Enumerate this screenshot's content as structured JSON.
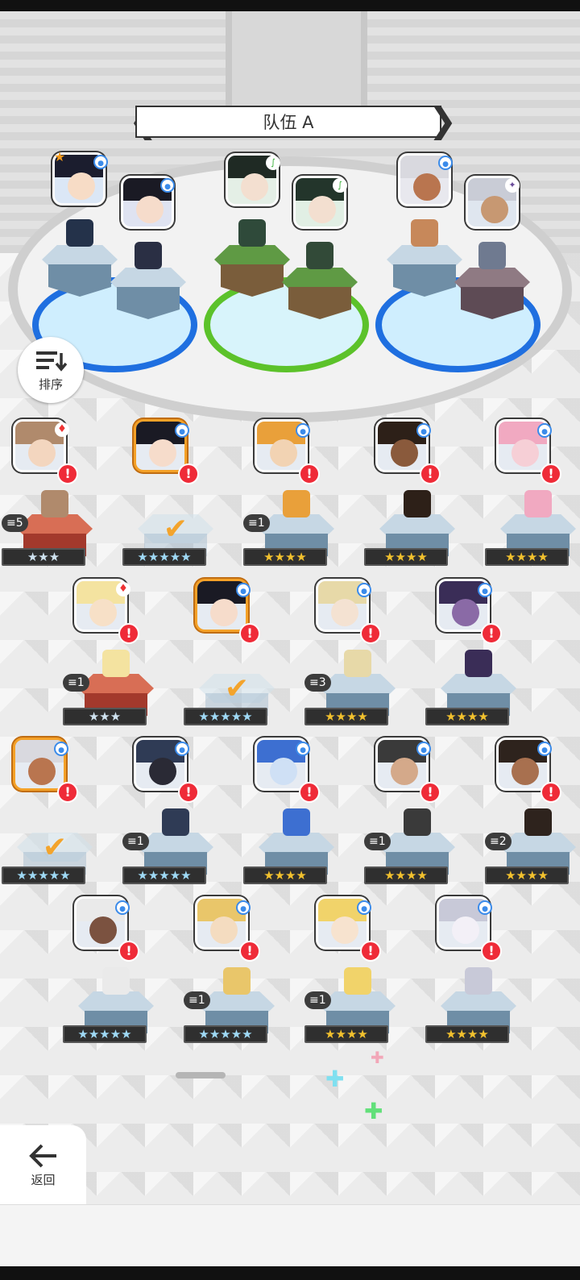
{
  "team": {
    "title": "队伍 A",
    "prev_label": "❮",
    "next_label": "❯"
  },
  "sort_button": {
    "label": "排序",
    "icon": "sort-icon"
  },
  "back_button": {
    "label": "返回",
    "icon": "back-arrow-icon"
  },
  "alert_glyph": "!",
  "check_glyph": "✔",
  "colors": {
    "accent_orange": "#f4a128",
    "alert_red": "#ef2b38",
    "element_blue": "#3b8bea",
    "team_blue_ring": "#1f6fe0",
    "team_green_ring": "#5cc22a",
    "star_gold": "#f2c12e"
  },
  "team_slots": [
    {
      "name": "team-slot-1",
      "ring": "blue",
      "members": [
        {
          "name": "lead-hero",
          "element": "blue",
          "role": "leader-star"
        },
        {
          "name": "hero-2",
          "element": "blue"
        }
      ]
    },
    {
      "name": "team-slot-2",
      "ring": "green",
      "members": [
        {
          "name": "hero-3",
          "element": "green"
        },
        {
          "name": "hero-4",
          "element": "green"
        }
      ]
    },
    {
      "name": "team-slot-3",
      "ring": "blue",
      "members": [
        {
          "name": "hero-5",
          "element": "blue"
        },
        {
          "name": "hero-6",
          "element": "purple"
        }
      ]
    }
  ],
  "roster": [
    {
      "stars": "★★★",
      "star_color": "silver",
      "count": "5",
      "element": "red",
      "selected": false,
      "alert": true
    },
    {
      "stars": "★★★★★",
      "star_color": "rainbow",
      "count": "",
      "element": "blue",
      "selected": true,
      "alert": true
    },
    {
      "stars": "★★★★",
      "star_color": "gold",
      "count": "1",
      "element": "blue",
      "selected": false,
      "alert": true
    },
    {
      "stars": "★★★★",
      "star_color": "gold",
      "count": "",
      "element": "blue",
      "selected": false,
      "alert": true
    },
    {
      "stars": "★★★★",
      "star_color": "gold",
      "count": "",
      "element": "blue",
      "selected": false,
      "alert": true
    },
    {
      "stars": "★★★",
      "star_color": "silver",
      "count": "1",
      "element": "red",
      "selected": false,
      "alert": true
    },
    {
      "stars": "★★★★★",
      "star_color": "rainbow",
      "count": "",
      "element": "blue",
      "selected": true,
      "alert": true
    },
    {
      "stars": "★★★★",
      "star_color": "gold",
      "count": "3",
      "element": "blue",
      "selected": false,
      "alert": true
    },
    {
      "stars": "★★★★",
      "star_color": "gold",
      "count": "",
      "element": "blue",
      "selected": false,
      "alert": true
    },
    {
      "stars": "★★★★★",
      "star_color": "rainbow",
      "count": "",
      "element": "blue",
      "selected": true,
      "alert": true
    },
    {
      "stars": "★★★★★",
      "star_color": "rainbow",
      "count": "1",
      "element": "blue",
      "selected": false,
      "alert": true
    },
    {
      "stars": "★★★★",
      "star_color": "gold",
      "count": "",
      "element": "blue",
      "selected": false,
      "alert": true
    },
    {
      "stars": "★★★★",
      "star_color": "gold",
      "count": "1",
      "element": "blue",
      "selected": false,
      "alert": true
    },
    {
      "stars": "★★★★",
      "star_color": "gold",
      "count": "2",
      "element": "blue",
      "selected": false,
      "alert": true
    },
    {
      "stars": "★★★★★",
      "star_color": "rainbow",
      "count": "",
      "element": "blue",
      "selected": false,
      "alert": true
    },
    {
      "stars": "★★★★★",
      "star_color": "rainbow",
      "count": "1",
      "element": "blue",
      "selected": false,
      "alert": true
    },
    {
      "stars": "★★★★",
      "star_color": "gold",
      "count": "1",
      "element": "blue",
      "selected": false,
      "alert": true
    },
    {
      "stars": "★★★★",
      "star_color": "gold",
      "count": "",
      "element": "blue",
      "selected": false,
      "alert": true
    }
  ]
}
